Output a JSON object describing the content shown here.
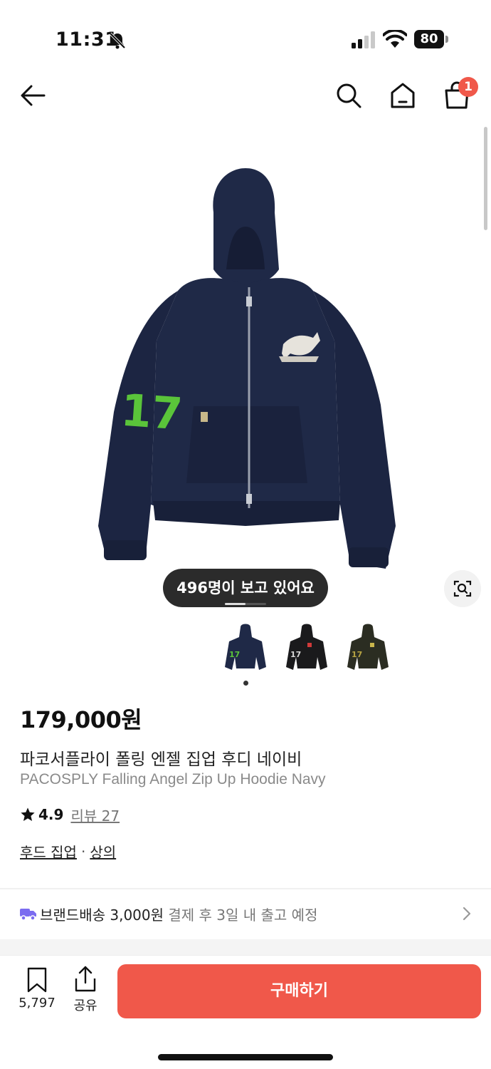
{
  "status_bar": {
    "time": "11:31",
    "battery": "80"
  },
  "nav": {
    "cart_count": "1"
  },
  "gallery": {
    "viewers_text": "496명이 보고 있어요",
    "image_index_fraction": 0.5
  },
  "product": {
    "price": "179,000원",
    "title_ko": "파코서플라이 폴링 엔젤 집업 후디 네이비",
    "title_en": "PACOSPLY Falling Angel Zip Up Hoodie Navy",
    "rating": "4.9",
    "review_label": "리뷰 27",
    "category_1": "후드 집업",
    "category_sep": "·",
    "category_2": "상의"
  },
  "shipping": {
    "main": "브랜드배송 3,000원",
    "sub": "결제 후 3일 내 출고 예정"
  },
  "bottom_bar": {
    "bookmark_count": "5,797",
    "share_label": "공유",
    "buy_label": "구매하기"
  },
  "colors": {
    "accent": "#f0584a",
    "truck": "#7b6cf0",
    "hoodie_navy": "#1f2947",
    "badge_green": "#5ac43a"
  }
}
